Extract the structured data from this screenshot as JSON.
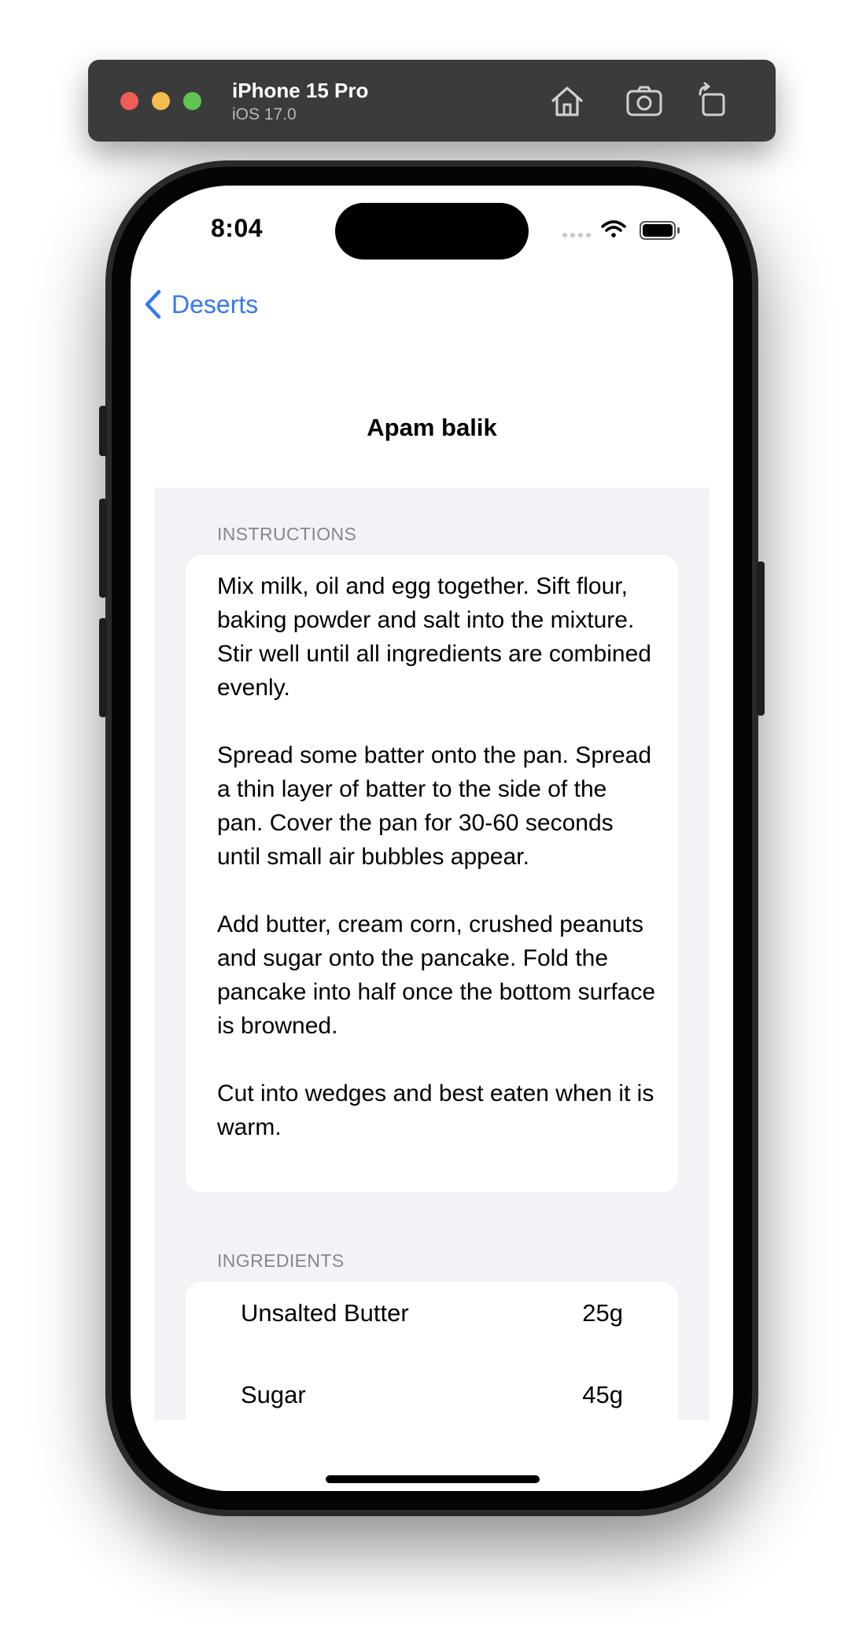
{
  "simulator": {
    "device_name": "iPhone 15 Pro",
    "os_version": "iOS 17.0",
    "icons": [
      "home-icon",
      "screenshot-icon",
      "rotate-icon"
    ]
  },
  "status_bar": {
    "time": "8:04",
    "icons": [
      "signal-icon",
      "wifi-icon",
      "battery-icon"
    ]
  },
  "nav": {
    "back_label": "Deserts",
    "title": "Apam balik"
  },
  "instructions": {
    "header": "INSTRUCTIONS",
    "paragraphs": [
      "Mix milk, oil and egg together. Sift flour, baking powder and salt into the mixture. Stir well until all ingredients are combined evenly.",
      "Spread some batter onto the pan. Spread a thin layer of batter to the side of the pan. Cover the pan for 30-60 seconds until small air bubbles appear.",
      "Add butter, cream corn, crushed peanuts and sugar onto the pancake. Fold the pancake into half once the bottom surface is browned.",
      "Cut into wedges and best eaten when it is warm."
    ]
  },
  "ingredients": {
    "header": "INGREDIENTS",
    "items": [
      {
        "name": "Unsalted Butter",
        "quantity": "25g"
      },
      {
        "name": "Sugar",
        "quantity": "45g"
      }
    ]
  },
  "colors": {
    "accent": "#3478f6",
    "grouped_background": "#f2f2f7",
    "secondary_label": "#86868b"
  }
}
